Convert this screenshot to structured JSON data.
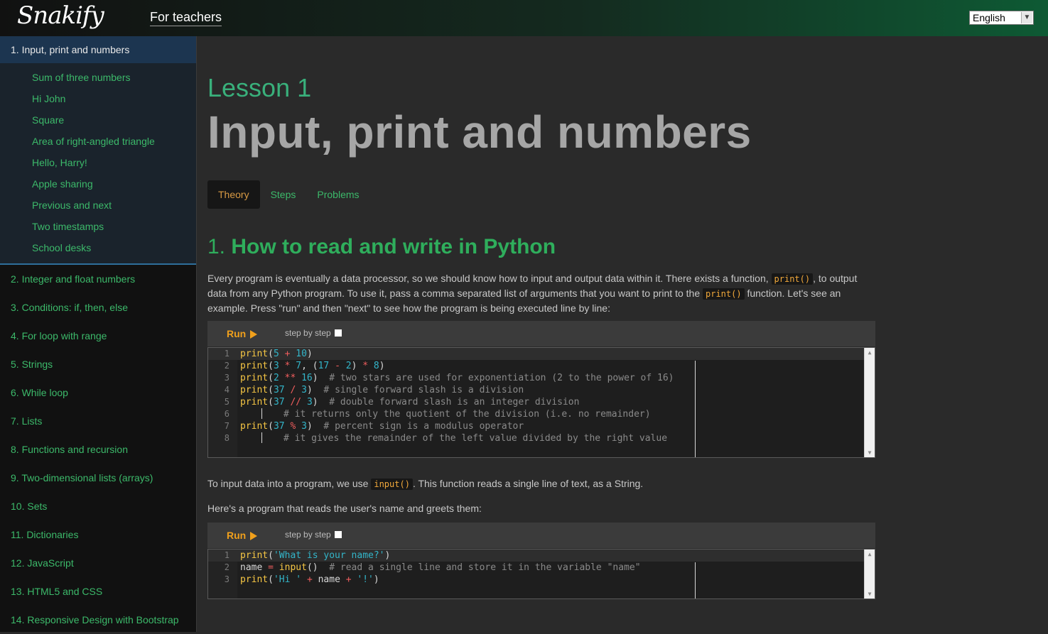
{
  "header": {
    "logo": "Snakify",
    "teachers_link": "For teachers",
    "language": "English"
  },
  "sidebar": {
    "current_lesson": "1. Input, print and numbers",
    "sub_items": [
      "Sum of three numbers",
      "Hi John",
      "Square",
      "Area of right-angled triangle",
      "Hello, Harry!",
      "Apple sharing",
      "Previous and next",
      "Two timestamps",
      "School desks"
    ],
    "lessons": [
      "2. Integer and float numbers",
      "3. Conditions: if, then, else",
      "4. For loop with range",
      "5. Strings",
      "6. While loop",
      "7. Lists",
      "8. Functions and recursion",
      "9. Two-dimensional lists (arrays)",
      "10. Sets",
      "11. Dictionaries",
      "12. JavaScript",
      "13. HTML5 and CSS",
      "14. Responsive Design with Bootstrap"
    ]
  },
  "main": {
    "lesson_number": "Lesson 1",
    "lesson_title": "Input, print and numbers",
    "tabs": [
      "Theory",
      "Steps",
      "Problems"
    ],
    "section_number": "1.",
    "section_title": "How to read and write in Python",
    "para1_a": "Every program is eventually a data processor, so we should know how to input and output data within it. There exists a function, ",
    "para1_code1": "print()",
    "para1_b": ", to output data from any Python program. To use it, pass a comma separated list of arguments that you want to print to the ",
    "para1_code2": "print()",
    "para1_c": " function. Let's see an example. Press \"run\" and then \"next\" to see how the program is being executed line by line:",
    "para2_a": "To input data into a program, we use ",
    "para2_code": "input()",
    "para2_b": ". This function reads a single line of text, as a String.",
    "para3": "Here's a program that reads the user's name and greets them:",
    "run_label": "Run",
    "step_label": "step by step"
  },
  "code1": [
    [
      "1",
      "print(5 + 10)"
    ],
    [
      "2",
      "print(3 * 7, (17 - 2) * 8)"
    ],
    [
      "3",
      "print(2 ** 16)  # two stars are used for exponentiation (2 to the power of 16)"
    ],
    [
      "4",
      "print(37 / 3)  # single forward slash is a division"
    ],
    [
      "5",
      "print(37 // 3)  # double forward slash is an integer division"
    ],
    [
      "6",
      "# it returns only the quotient of the division (i.e. no remainder)"
    ],
    [
      "7",
      "print(37 % 3)  # percent sign is a modulus operator"
    ],
    [
      "8",
      "# it gives the remainder of the left value divided by the right value"
    ]
  ],
  "code2": [
    [
      "1",
      "print('What is your name?')"
    ],
    [
      "2",
      "name = input()  # read a single line and store it in the variable \"name\""
    ],
    [
      "3",
      "print('Hi ' + name + '!')"
    ]
  ]
}
